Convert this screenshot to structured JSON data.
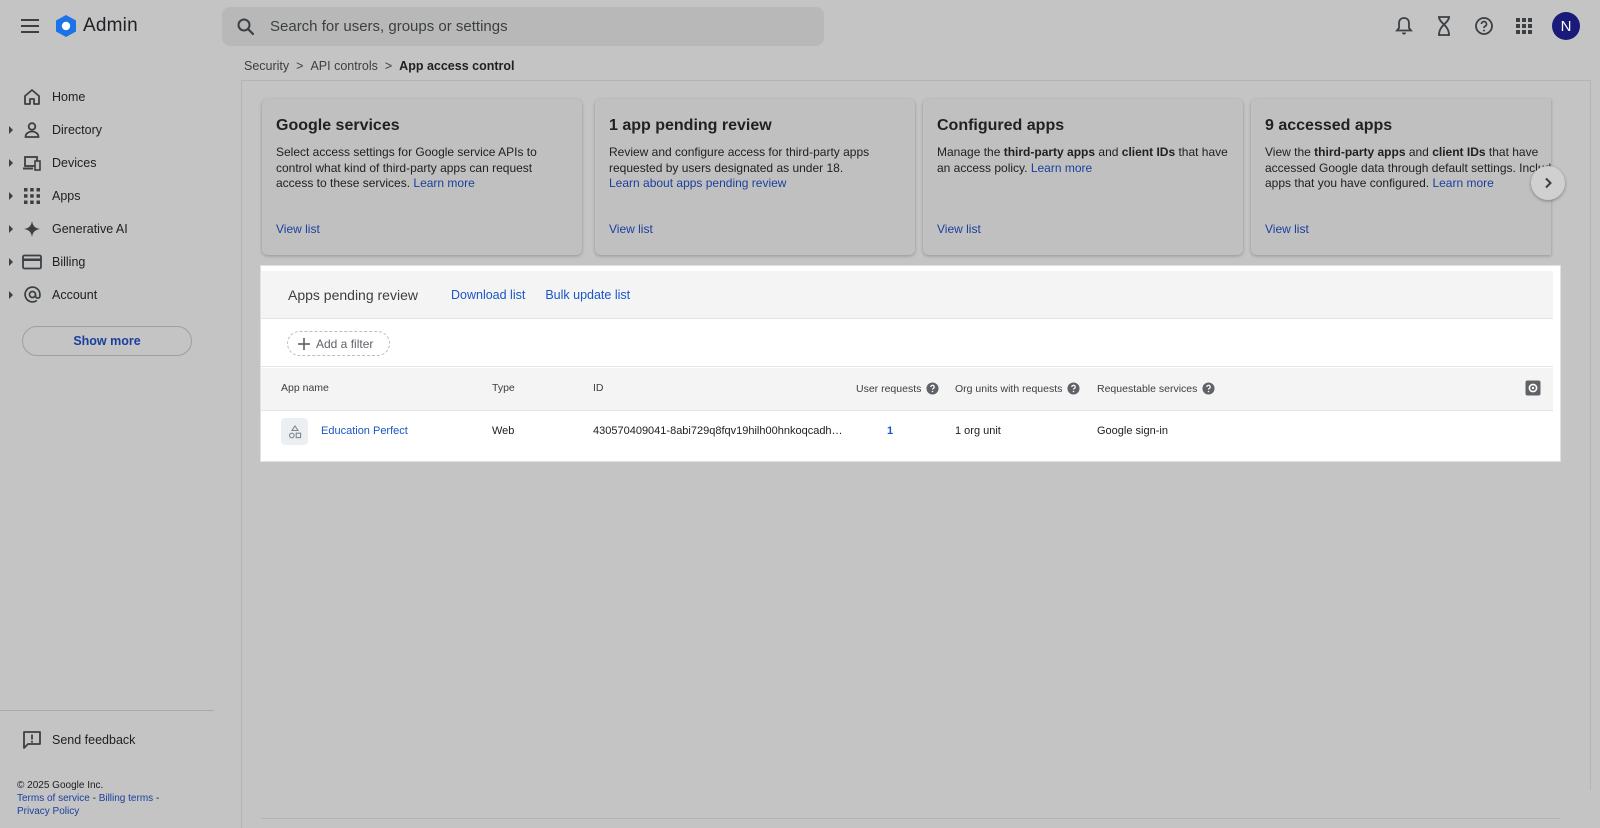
{
  "header": {
    "app_name": "Admin",
    "search_placeholder": "Search for users, groups or settings",
    "avatar_initial": "N"
  },
  "breadcrumb": {
    "items": [
      "Security",
      "API controls"
    ],
    "current": "App access control"
  },
  "sidebar": {
    "items": [
      {
        "label": "Home",
        "icon": "home-icon",
        "expandable": false
      },
      {
        "label": "Directory",
        "icon": "person-icon",
        "expandable": true
      },
      {
        "label": "Devices",
        "icon": "devices-icon",
        "expandable": true
      },
      {
        "label": "Apps",
        "icon": "apps-grid-icon",
        "expandable": true
      },
      {
        "label": "Generative AI",
        "icon": "sparkle-icon",
        "expandable": true
      },
      {
        "label": "Billing",
        "icon": "credit-card-icon",
        "expandable": true
      },
      {
        "label": "Account",
        "icon": "at-sign-icon",
        "expandable": true
      }
    ],
    "show_more": "Show more",
    "feedback": "Send feedback",
    "footer": {
      "copyright": "© 2025 Google Inc.",
      "terms": "Terms of service",
      "billing_terms": "Billing terms",
      "privacy": "Privacy Policy"
    }
  },
  "cards": [
    {
      "title": "Google services",
      "desc_before": "Select access settings for Google service APIs to control what kind of third-party apps can request access to these services. ",
      "desc_link": "Learn more",
      "link": "View list"
    },
    {
      "title": "1 app pending review",
      "desc_before": "Review and configure access for third-party apps requested by users designated as under 18.",
      "desc_link": "Learn about apps pending review",
      "link": "View list"
    },
    {
      "title": "Configured apps",
      "desc_parts": [
        "Manage the ",
        "third-party apps",
        " and ",
        "client IDs",
        " that have an access policy. "
      ],
      "desc_link": "Learn more",
      "link": "View list"
    },
    {
      "title": "9 accessed apps",
      "desc_parts": [
        "View the ",
        "third-party apps",
        " and ",
        "client IDs",
        " that have accessed Google data through default settings. Includ apps that you have configured. "
      ],
      "desc_link": "Learn more",
      "link": "View list"
    }
  ],
  "panel": {
    "title": "Apps pending review",
    "download": "Download list",
    "bulk_update": "Bulk update list",
    "add_filter": "Add a filter",
    "columns": {
      "app_name": "App name",
      "type": "Type",
      "id": "ID",
      "user_requests": "User requests",
      "org_units": "Org units with requests",
      "services": "Requestable services"
    },
    "rows": [
      {
        "app_name": "Education Perfect",
        "type": "Web",
        "id": "430570409041-8abi729q8fqv19hilh00hnkoqcadh…",
        "user_requests": "1",
        "org_units": "1 org unit",
        "services": "Google sign-in"
      }
    ]
  },
  "colors": {
    "overlay_bg": "#c4c4c4",
    "link_blue": "#1a56c4",
    "avatar_bg": "#1a1a7a",
    "logo_blue": "#1a73e8"
  }
}
